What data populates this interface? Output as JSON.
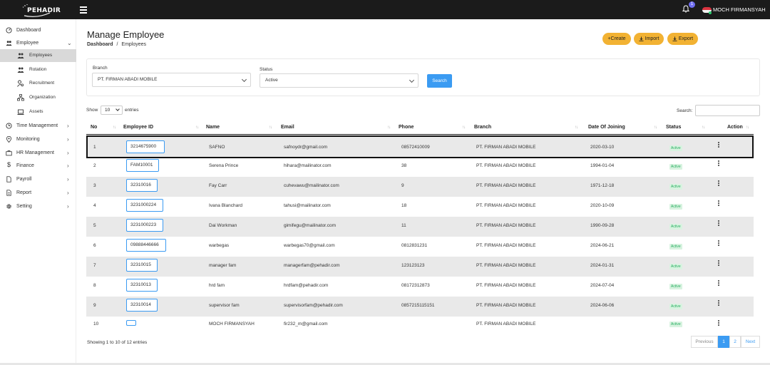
{
  "topbar": {
    "logo_text": "PEHADIR",
    "notification_count": "1",
    "user_name": "MOCH FIRMANSYAH"
  },
  "sidebar": {
    "items": [
      {
        "label": "Dashboard",
        "icon": "gauge-icon"
      },
      {
        "label": "Employee",
        "icon": "users-icon"
      },
      {
        "label": "Time Management",
        "icon": "clock-icon"
      },
      {
        "label": "Monitoring",
        "icon": "location-pin-icon"
      },
      {
        "label": "HR Management",
        "icon": "briefcase-icon"
      },
      {
        "label": "Finance",
        "icon": "dollar-icon"
      },
      {
        "label": "Payroll",
        "icon": "file-icon"
      },
      {
        "label": "Report",
        "icon": "document-icon"
      },
      {
        "label": "Setting",
        "icon": "gear-icon"
      }
    ],
    "employee_sub": [
      {
        "label": "Employees",
        "icon": "users-icon"
      },
      {
        "label": "Rotation",
        "icon": "rotation-users-icon"
      },
      {
        "label": "Recruitment",
        "icon": "user-search-icon"
      },
      {
        "label": "Organization",
        "icon": "org-chart-icon"
      },
      {
        "label": "Assets",
        "icon": "laptop-icon"
      }
    ]
  },
  "header": {
    "title": "Manage Employee",
    "breadcrumb_root": "Dashboard",
    "breadcrumb_sep": "/",
    "breadcrumb_current": "Employees",
    "create_label": "+Create",
    "import_label": "Import",
    "export_label": "Export"
  },
  "filters": {
    "branch_label": "Branch",
    "branch_value": "PT. FIRMAN ABADI MOBILE",
    "status_label": "Status",
    "status_value": "Active",
    "search_button": "Search"
  },
  "table_controls": {
    "show_label": "Show",
    "entries_value": "10",
    "entries_label": "entries",
    "search_label": "Search:",
    "search_value": ""
  },
  "table": {
    "headers": [
      "No",
      "Employee ID",
      "Name",
      "Email",
      "Phone",
      "Branch",
      "Date Of Joining",
      "Status",
      "Action"
    ],
    "rows": [
      {
        "no": "1",
        "id": "3214675900",
        "name": "SAFNO",
        "email": "safnoydr@gmail.com",
        "phone": "08572410009",
        "branch": "PT. FIRMAN ABADI MOBILE",
        "date": "2020-03-10",
        "status": "Active"
      },
      {
        "no": "2",
        "id": "FAM10001",
        "name": "Serena Prince",
        "email": "hihara@mailinator.com",
        "phone": "38",
        "branch": "PT. FIRMAN ABADI MOBILE",
        "date": "1994-01-04",
        "status": "Active"
      },
      {
        "no": "3",
        "id": "32310016",
        "name": "Fay Carr",
        "email": "cuhevawu@mailinator.com",
        "phone": "9",
        "branch": "PT. FIRMAN ABADI MOBILE",
        "date": "1971-12-18",
        "status": "Active"
      },
      {
        "no": "4",
        "id": "3231000224",
        "name": "Ivana Blanchard",
        "email": "tahusi@mailinator.com",
        "phone": "18",
        "branch": "PT. FIRMAN ABADI MOBILE",
        "date": "2020-10-09",
        "status": "Active"
      },
      {
        "no": "5",
        "id": "3231000223",
        "name": "Dai Workman",
        "email": "gimifegu@mailinator.com",
        "phone": "11",
        "branch": "PT. FIRMAN ABADI MOBILE",
        "date": "1990-09-28",
        "status": "Active"
      },
      {
        "no": "6",
        "id": "09888446666",
        "name": "warbegas",
        "email": "warbegas70@gmail.com",
        "phone": "0812831231",
        "branch": "PT. FIRMAN ABADI MOBILE",
        "date": "2024-06-21",
        "status": "Active"
      },
      {
        "no": "7",
        "id": "32310015",
        "name": "manager fam",
        "email": "managerfam@pehadir.com",
        "phone": "123123123",
        "branch": "PT. FIRMAN ABADI MOBILE",
        "date": "2024-01-31",
        "status": "Active"
      },
      {
        "no": "8",
        "id": "32310013",
        "name": "hrd fam",
        "email": "hrdfam@pehadir.com",
        "phone": "08172312873",
        "branch": "PT. FIRMAN ABADI MOBILE",
        "date": "2024-07-04",
        "status": "Active"
      },
      {
        "no": "9",
        "id": "32310014",
        "name": "supervisor fam",
        "email": "supervisorfam@pehadir.com",
        "phone": "0857215115151",
        "branch": "PT. FIRMAN ABADI MOBILE",
        "date": "2024-06-06",
        "status": "Active"
      },
      {
        "no": "10",
        "id": "",
        "name": "MOCH FIRMANSYAH",
        "email": "fir232_m@gmail.com",
        "phone": "",
        "branch": "PT. FIRMAN ABADI MOBILE",
        "date": "",
        "status": "Active"
      }
    ]
  },
  "footer": {
    "info": "Showing 1 to 10 of 12 entries",
    "previous": "Previous",
    "page1": "1",
    "page2": "2",
    "next": "Next"
  },
  "colors": {
    "accent": "#3b9bf2",
    "button_yellow": "#f2b233",
    "topbar": "#1b1b1b",
    "status_green": "#27ae60"
  }
}
